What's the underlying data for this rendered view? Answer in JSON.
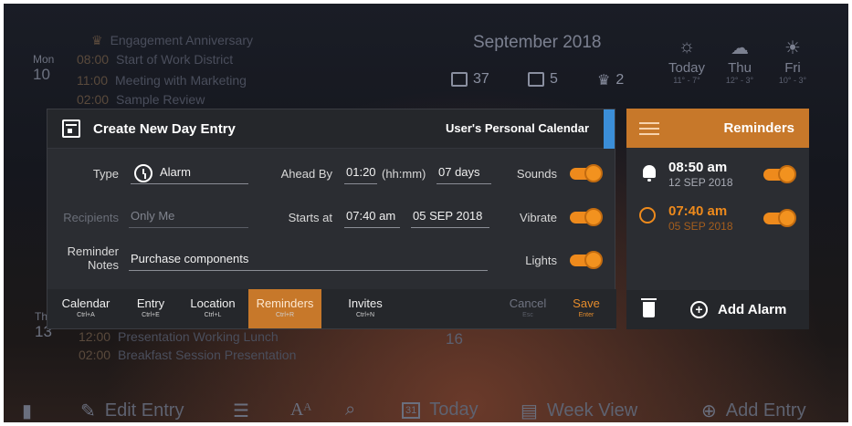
{
  "background": {
    "month_title": "September 2018",
    "stats": [
      {
        "icon": "calendar-icon",
        "value": "37"
      },
      {
        "icon": "checkbox-icon",
        "value": "5"
      },
      {
        "icon": "cake-icon",
        "value": "2"
      }
    ],
    "weather": [
      {
        "day": "Today",
        "range": "11° - 7°",
        "icon": "partly-sunny-icon"
      },
      {
        "day": "Thu",
        "range": "12° - 3°",
        "icon": "rain-cloud-icon"
      },
      {
        "day": "Fri",
        "range": "10° - 3°",
        "icon": "sun-icon"
      }
    ],
    "days": [
      {
        "name": "Mon",
        "num": "10"
      },
      {
        "name": "Th",
        "num": "13"
      }
    ],
    "events_top": [
      {
        "time": "",
        "text": "Engagement Anniversary"
      },
      {
        "time": "08:00",
        "text": "Start of Work District"
      },
      {
        "time": "11:00",
        "text": "Meeting with Marketing"
      },
      {
        "time": "02:00",
        "text": "Sample Review"
      }
    ],
    "events_bottom": [
      {
        "time": "12:00",
        "text": "Presentation Working Lunch"
      },
      {
        "time": "02:00",
        "text": "Breakfast Session Presentation"
      }
    ],
    "date_16": "16"
  },
  "dialog": {
    "title": "Create New Day Entry",
    "calendar_name": "User's Personal Calendar",
    "type_label": "Type",
    "type_value": "Alarm",
    "ahead_label": "Ahead By",
    "ahead_time": "01:20",
    "ahead_unit": "(hh:mm)",
    "ahead_days": "07 days",
    "sounds_label": "Sounds",
    "recipients_label": "Recipients",
    "recipients_value": "Only Me",
    "starts_label": "Starts at",
    "start_time": "07:40 am",
    "start_date": "05 SEP 2018",
    "vibrate_label": "Vibrate",
    "notes_label_1": "Reminder",
    "notes_label_2": "Notes",
    "notes_value": "Purchase components",
    "lights_label": "Lights",
    "toggles": {
      "sounds": true,
      "vibrate": true,
      "lights": true
    },
    "tabs": [
      {
        "label": "Calendar",
        "key": "Ctrl+A"
      },
      {
        "label": "Entry",
        "key": "Ctrl+E"
      },
      {
        "label": "Location",
        "key": "Ctrl+L"
      },
      {
        "label": "Reminders",
        "key": "Ctrl+R"
      },
      {
        "label": "Invites",
        "key": "Ctrl+N"
      }
    ],
    "cancel": {
      "label": "Cancel",
      "key": "Esc"
    },
    "save": {
      "label": "Save",
      "key": "Enter"
    }
  },
  "reminders": {
    "title": "Reminders",
    "items": [
      {
        "time": "08:50 am",
        "date": "12 SEP 2018",
        "icon": "bell-icon",
        "enabled": true
      },
      {
        "time": "07:40 am",
        "date": "05 SEP 2018",
        "icon": "alarm-clock-icon",
        "enabled": true
      }
    ],
    "add_label": "Add Alarm"
  },
  "toolbar": {
    "edit_entry": "Edit Entry",
    "today": "Today",
    "today_num": "31",
    "week_view": "Week View",
    "add_entry": "Add Entry"
  },
  "colors": {
    "accent": "#c7782a",
    "toggle": "#ee8a1c",
    "panel": "#2b2d32",
    "header": "#25272b",
    "blue": "#3b8ed8"
  }
}
